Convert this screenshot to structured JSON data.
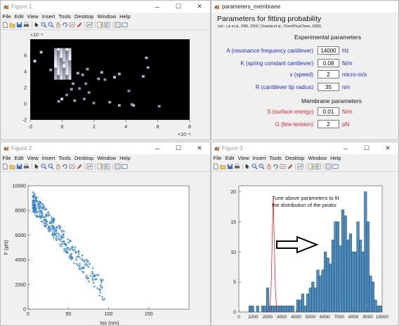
{
  "menu": [
    "File",
    "Edit",
    "View",
    "Insert",
    "Tools",
    "Desktop",
    "Window",
    "Help"
  ],
  "fig1": {
    "title": "Figure 1",
    "x_exponent": "×10⁻⁶",
    "y_exponent": "×10⁻⁶",
    "xticks": [
      "-2",
      "0",
      "2",
      "4",
      "6",
      "8"
    ],
    "yticks": [
      "-2",
      "0",
      "2",
      "4",
      "6",
      "8"
    ]
  },
  "panel": {
    "window_title": "parameters_membrane",
    "title": "Parameters for fitting probability",
    "reference": "(ref.: Loi et al., PRE, 2002; Chiantia et al., ChemPhysChem, 2006)",
    "exp_header": "Experimental parameters",
    "mem_header": "Membrane parameters",
    "rows": [
      {
        "label": "A (resonance frequency cantilever)",
        "value": "14000",
        "unit": "Hz",
        "color": "#1f2bd6"
      },
      {
        "label": "K (spring constant cantilever)",
        "value": "0.08",
        "unit": "N/m",
        "color": "#1f2bd6"
      },
      {
        "label": "v (speed)",
        "value": "2",
        "unit": "micro-m/s",
        "color": "#1f2bd6"
      },
      {
        "label": "R (cantilever tip radius)",
        "value": "35",
        "unit": "nm",
        "color": "#1f2bd6"
      },
      {
        "label": "S (surface energy)",
        "value": "0.01",
        "unit": "N/m",
        "color": "#e0242a"
      },
      {
        "label": "G (line tension)",
        "value": "2",
        "unit": "pN",
        "color": "#e0242a"
      }
    ]
  },
  "fig2": {
    "title": "Figure 2",
    "ylabel": "F (pN)",
    "xlabel": "tss (nm)",
    "yticks": [
      "0",
      "2000",
      "4000",
      "6000",
      "8000",
      "10000"
    ],
    "xticks": [
      "0",
      "50",
      "100",
      "150"
    ]
  },
  "fig3": {
    "title": "Figure 3",
    "annotation_line1": "Tune above parameters to fit",
    "annotation_line2": "the distribution of the peaks",
    "yticks": [
      "0",
      "5",
      "10",
      "15",
      "20"
    ],
    "xticks": [
      "0",
      "1000",
      "2000",
      "3000",
      "4000",
      "5000",
      "6000",
      "7000",
      "8000",
      "9000",
      "10000"
    ]
  },
  "chart_data": [
    {
      "type": "heatmap",
      "title": "",
      "x_exponent": "×10⁻⁶",
      "y_exponent": "×10⁻⁶",
      "xlim": [
        -2,
        8
      ],
      "ylim": [
        -2,
        8
      ],
      "cells": [
        [
          -1.8,
          5.2,
          0.8
        ],
        [
          -1.4,
          6.3,
          0.7
        ],
        [
          -0.8,
          4.1,
          0.5
        ],
        [
          0.0,
          5.0,
          0.4
        ],
        [
          0.4,
          4.7,
          0.5
        ],
        [
          0.9,
          3.7,
          0.6
        ],
        [
          0.6,
          2.4,
          0.5
        ],
        [
          1.0,
          1.8,
          0.4
        ],
        [
          1.2,
          3.5,
          0.5
        ],
        [
          1.5,
          4.2,
          0.5
        ],
        [
          2.4,
          3.8,
          0.6
        ],
        [
          2.6,
          2.9,
          0.4
        ],
        [
          3.2,
          3.2,
          0.7
        ],
        [
          3.5,
          3.6,
          0.6
        ],
        [
          5.2,
          5.6,
          0.6
        ],
        [
          5.3,
          4.4,
          0.5
        ],
        [
          5.0,
          3.3,
          0.6
        ],
        [
          4.1,
          1.5,
          0.4
        ],
        [
          3.5,
          -0.3,
          0.6
        ],
        [
          4.3,
          -0.2,
          0.5
        ],
        [
          2.9,
          0.1,
          0.5
        ],
        [
          1.9,
          0.0,
          0.4
        ],
        [
          1.6,
          1.3,
          0.4
        ],
        [
          -0.1,
          0.5,
          0.8
        ],
        [
          -0.3,
          0.2,
          0.5
        ],
        [
          0.2,
          1.0,
          0.4
        ],
        [
          0.5,
          1.7,
          0.5
        ],
        [
          1.4,
          2.4,
          0.4
        ],
        [
          2.2,
          3.0,
          0.5
        ],
        [
          4.4,
          -0.3,
          0.6
        ],
        [
          6.0,
          -0.4,
          0.4
        ],
        [
          1.3,
          0.5,
          0.4
        ],
        [
          0.7,
          0.3,
          0.5
        ]
      ],
      "hot_x": [
        -0.5,
        0.4
      ],
      "hot_y": [
        3.0,
        6.6
      ]
    },
    {
      "type": "scatter",
      "xlabel": "tss (nm)",
      "ylabel": "F (pN)",
      "xlim": [
        0,
        200
      ],
      "ylim": [
        0,
        10000
      ],
      "n_points": 320
    },
    {
      "type": "bar",
      "title": "",
      "xlim": [
        0,
        10000
      ],
      "ylim": [
        0,
        21
      ],
      "bin_width": 175,
      "bins_start": 700,
      "values": [
        1,
        1,
        0,
        1,
        0,
        1,
        1,
        4,
        1,
        1,
        1,
        1,
        1,
        1,
        1,
        1,
        1,
        1,
        0,
        2,
        2,
        3,
        1,
        3,
        4,
        5,
        4,
        7,
        6,
        7,
        10,
        9,
        8,
        12,
        15,
        15,
        11,
        17,
        16,
        12,
        13,
        10,
        10,
        15,
        12,
        10,
        20,
        15,
        6,
        5,
        2,
        1,
        1
      ],
      "fit_curve": [
        [
          2150,
          0
        ],
        [
          2250,
          4
        ],
        [
          2330,
          12
        ],
        [
          2400,
          19
        ],
        [
          2470,
          12
        ],
        [
          2550,
          4
        ],
        [
          2650,
          0
        ]
      ]
    }
  ]
}
